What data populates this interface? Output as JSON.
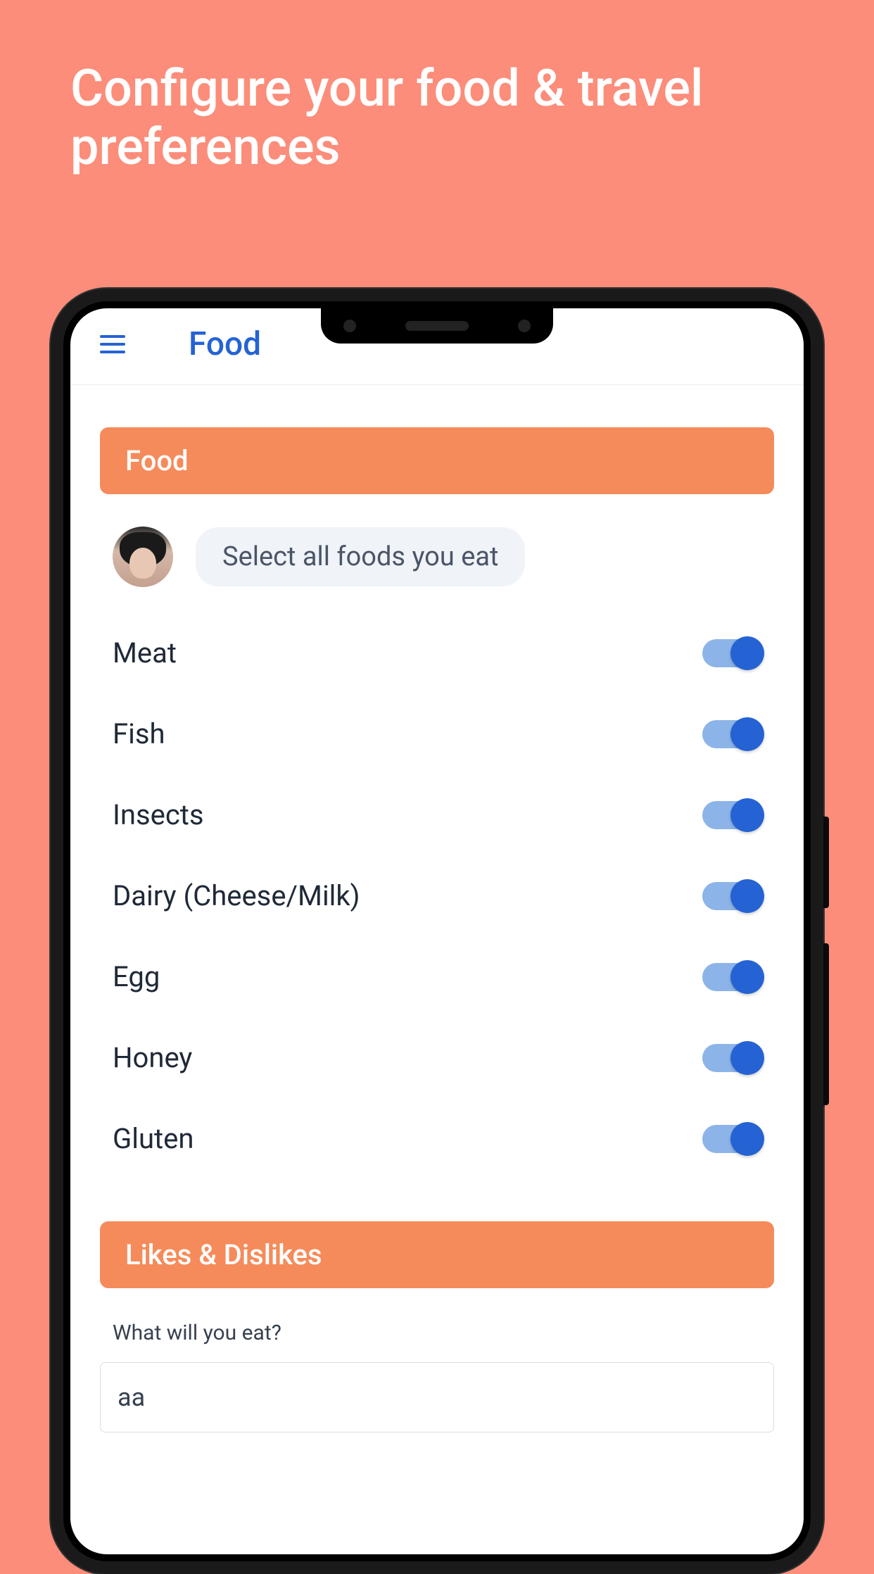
{
  "promo": {
    "title": "Configure your food & travel preferences"
  },
  "header": {
    "title": "Food"
  },
  "sections": {
    "food": {
      "title": "Food",
      "prompt": "Select all foods you eat",
      "items": [
        {
          "label": "Meat",
          "on": true
        },
        {
          "label": "Fish",
          "on": true
        },
        {
          "label": "Insects",
          "on": true
        },
        {
          "label": "Dairy (Cheese/Milk)",
          "on": true
        },
        {
          "label": "Egg",
          "on": true
        },
        {
          "label": "Honey",
          "on": true
        },
        {
          "label": "Gluten",
          "on": true
        }
      ]
    },
    "likes": {
      "title": "Likes & Dislikes",
      "question": "What will you eat?",
      "input_value": "aa"
    }
  }
}
